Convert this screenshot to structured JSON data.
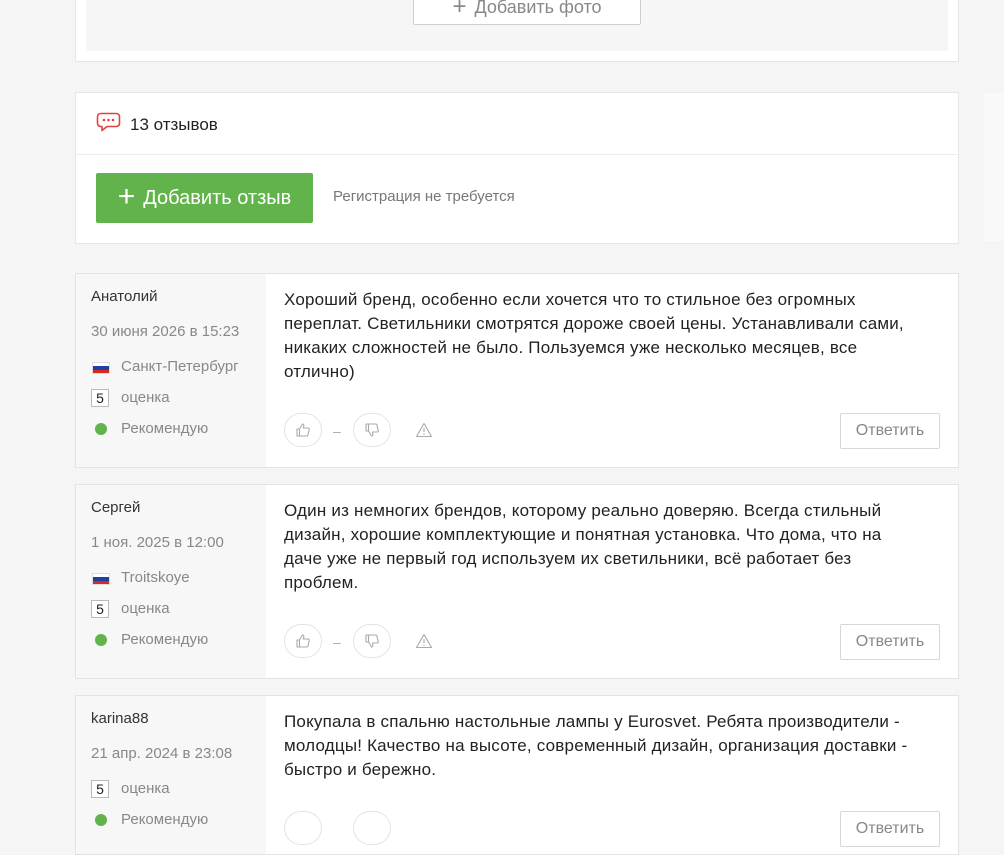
{
  "photo": {
    "add_label": "Добавить фото"
  },
  "reviews_header": {
    "count_label": "13 отзывов",
    "add_review_label": "Добавить отзыв",
    "no_registration": "Регистрация не требуется"
  },
  "colors": {
    "accent_green": "#62b34c",
    "icon_red": "#e0443e"
  },
  "reviews": [
    {
      "author": "Анатолий",
      "date": "30 июня 2026 в 15:23",
      "city": "Санкт-Петербург",
      "score": "5",
      "score_label": "оценка",
      "recommend": "Рекомендую",
      "text": "Хороший бренд, особенно если хочется что то стильное без огромных переплат. Светильники смотрятся дороже своей цены. Устанавливали сами, никаких сложностей не было. Пользуемся уже несколько месяцев, все отлично)",
      "vote_separator": "–",
      "reply_label": "Ответить"
    },
    {
      "author": "Сергей",
      "date": "1 ноя. 2025 в 12:00",
      "city": "Troitskoye",
      "score": "5",
      "score_label": "оценка",
      "recommend": "Рекомендую",
      "text": "Один из немногих брендов, которому реально доверяю. Всегда стильный дизайн, хорошие комплектующие и понятная установка. Что дома, что на даче уже не первый год используем их светильники, всё работает без проблем.",
      "vote_separator": "–",
      "reply_label": "Ответить"
    },
    {
      "author": "karina88",
      "date": "21 апр. 2024 в 23:08",
      "score": "5",
      "score_label": "оценка",
      "recommend": "Рекомендую",
      "text": "Покупала в спальню настольные лампы у Eurosvet. Ребята производители - молодцы! Качество на высоте, современный дизайн, организация доставки - быстро и бережно.",
      "reply_label": "Ответить"
    }
  ]
}
